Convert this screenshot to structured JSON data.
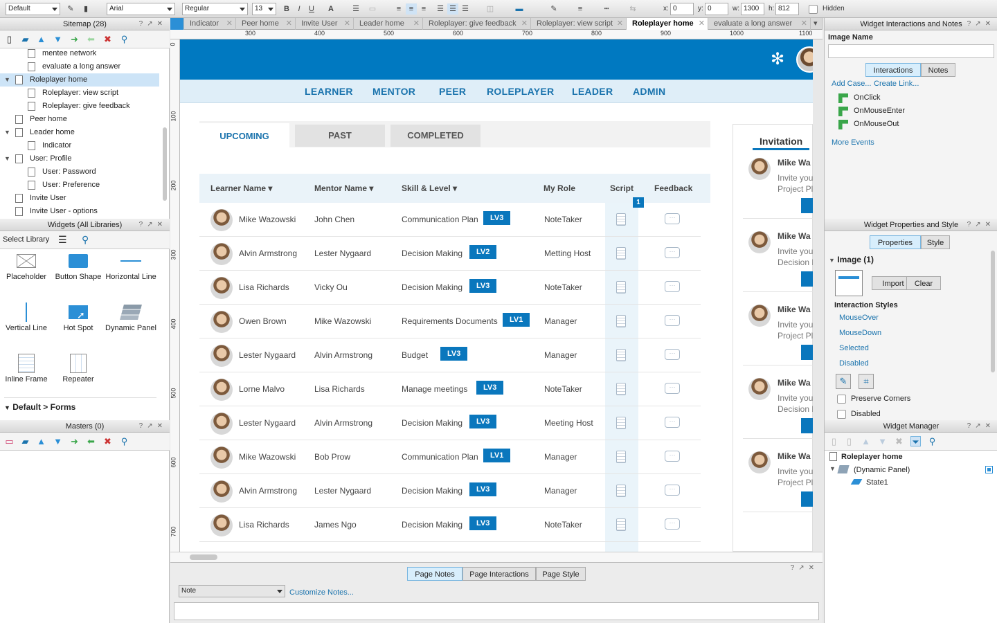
{
  "toolbar": {
    "style_select": "Default",
    "font_select": "Arial",
    "weight_select": "Regular",
    "size_select": "13",
    "x_label": "x:",
    "x_value": "0",
    "y_label": "y:",
    "y_value": "0",
    "w_label": "w:",
    "w_value": "1300",
    "h_label": "h:",
    "h_value": "812",
    "hidden_label": "Hidden"
  },
  "sitemap": {
    "title": "Sitemap (28)",
    "items": [
      "mentee network",
      "evaluate a long answer",
      "Roleplayer home",
      "Roleplayer: view script",
      "Roleplayer: give feedback",
      "Peer home",
      "Leader home",
      "Indicator",
      "User: Profile",
      "User: Password",
      "User: Preference",
      "Invite User",
      "Invite User - options"
    ]
  },
  "widgets": {
    "title": "Widgets (All Libraries)",
    "select_library": "Select Library",
    "items": [
      "Placeholder",
      "Button Shape",
      "Horizontal Line",
      "Vertical Line",
      "Hot Spot",
      "Dynamic Panel",
      "Inline Frame",
      "Repeater"
    ],
    "section": "Default > Forms"
  },
  "masters": {
    "title": "Masters (0)"
  },
  "tabs": [
    "Indicator",
    "Peer home",
    "Invite User",
    "Leader home",
    "Roleplayer: give feedback",
    "Roleplayer: view script",
    "Roleplayer home",
    "evaluate a long answer"
  ],
  "ruler": {
    "h": [
      "300",
      "400",
      "500",
      "600",
      "700",
      "800",
      "900",
      "1000",
      "1100"
    ],
    "v": [
      "0",
      "100",
      "200",
      "300",
      "400",
      "500",
      "600",
      "700"
    ]
  },
  "app": {
    "nav": [
      "LEARNER",
      "MENTOR",
      "PEER",
      "ROLEPLAYER",
      "LEADER",
      "ADMIN"
    ],
    "tabs": [
      "UPCOMING",
      "PAST",
      "COMPLETED"
    ],
    "headers": [
      "Learner Name",
      "Mentor Name",
      "Skill & Level",
      "My Role",
      "Script",
      "Feedback"
    ],
    "script_badge": "1",
    "rows": [
      {
        "learner": "Mike Wazowski",
        "mentor": "John Chen",
        "skill": "Communication Plan",
        "level": "LV3",
        "role": "NoteTaker"
      },
      {
        "learner": "Alvin Armstrong",
        "mentor": "Lester Nygaard",
        "skill": "Decision Making",
        "level": "LV2",
        "role": "Metting Host"
      },
      {
        "learner": "Lisa Richards",
        "mentor": "Vicky Ou",
        "skill": "Decision Making",
        "level": "LV3",
        "role": "NoteTaker"
      },
      {
        "learner": "Owen Brown",
        "mentor": "Mike Wazowski",
        "skill": "Requirements Documents",
        "level": "LV1",
        "role": "Manager"
      },
      {
        "learner": "Lester Nygaard",
        "mentor": "Alvin Armstrong",
        "skill": "Budget",
        "level": "LV3",
        "role": "Manager"
      },
      {
        "learner": "Lorne Malvo",
        "mentor": "Lisa Richards",
        "skill": "Manage meetings",
        "level": "LV3",
        "role": "NoteTaker"
      },
      {
        "learner": "Lester Nygaard",
        "mentor": "Alvin Armstrong",
        "skill": "Decision Making",
        "level": "LV3",
        "role": "Meeting Host"
      },
      {
        "learner": "Mike Wazowski",
        "mentor": "Bob Prow",
        "skill": "Communication Plan",
        "level": "LV1",
        "role": "Manager"
      },
      {
        "learner": "Alvin Armstrong",
        "mentor": "Lester Nygaard",
        "skill": "Decision Making",
        "level": "LV3",
        "role": "Manager"
      },
      {
        "learner": "Lisa Richards",
        "mentor": "James Ngo",
        "skill": "Decision Making",
        "level": "LV3",
        "role": "NoteTaker"
      }
    ],
    "invitation": {
      "title": "Invitation",
      "items": [
        {
          "name": "Mike Wa",
          "l1": "Invite you",
          "l2": "Project Pla"
        },
        {
          "name": "Mike Wa",
          "l1": "Invite you",
          "l2": "Decision M"
        },
        {
          "name": "Mike Wa",
          "l1": "Invite you",
          "l2": "Project Pla"
        },
        {
          "name": "Mike Wa",
          "l1": "Invite you",
          "l2": "Decision M"
        },
        {
          "name": "Mike Wa",
          "l1": "Invite you",
          "l2": "Project Pla"
        }
      ]
    }
  },
  "bottom": {
    "tabs": [
      "Page Notes",
      "Page Interactions",
      "Page Style"
    ],
    "note_select": "Note",
    "customize": "Customize Notes..."
  },
  "interactions": {
    "title": "Widget Interactions and Notes",
    "image_name_label": "Image Name",
    "tab_interactions": "Interactions",
    "tab_notes": "Notes",
    "add_case": "Add Case...",
    "create_link": "Create Link...",
    "events": [
      "OnClick",
      "OnMouseEnter",
      "OnMouseOut"
    ],
    "more_events": "More Events"
  },
  "properties": {
    "title": "Widget Properties and Style",
    "tab_properties": "Properties",
    "tab_style": "Style",
    "image_heading": "Image (1)",
    "import": "Import",
    "clear": "Clear",
    "interaction_styles": "Interaction Styles",
    "styles": [
      "MouseOver",
      "MouseDown",
      "Selected",
      "Disabled"
    ],
    "preserve_corners": "Preserve Corners",
    "disabled": "Disabled"
  },
  "manager": {
    "title": "Widget Manager",
    "root": "Roleplayer home",
    "panel": "(Dynamic Panel)",
    "state": "State1"
  }
}
